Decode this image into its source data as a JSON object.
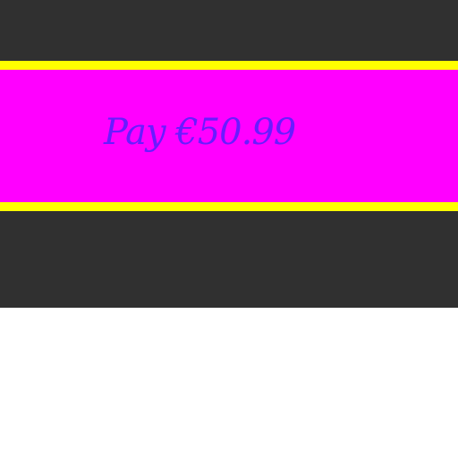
{
  "payment": {
    "button_label": "Pay €50.99"
  },
  "colors": {
    "panel_background": "#303030",
    "button_fill": "#ff00ff",
    "button_border": "#ffff00",
    "label_ink": "#6a1bff",
    "page_background": "#ffffff"
  }
}
